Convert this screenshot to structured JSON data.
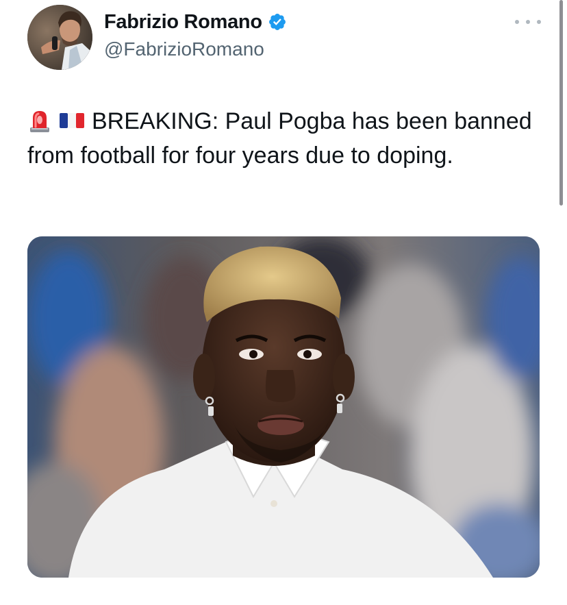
{
  "author": {
    "display_name": "Fabrizio Romano",
    "handle": "@FabrizioRomano",
    "verified": true
  },
  "tweet": {
    "text": "BREAKING: Paul Pogba has been banned from football for four years due to doping.",
    "leading_emoji": [
      "rotating-light-emoji",
      "france-flag-emoji"
    ]
  },
  "media": {
    "type": "photo"
  },
  "colors": {
    "text": "#0f1419",
    "secondary": "#536471",
    "verified_badge": "#1d9bf0"
  },
  "icons": [
    "verified-badge-icon",
    "more-options-icon"
  ]
}
